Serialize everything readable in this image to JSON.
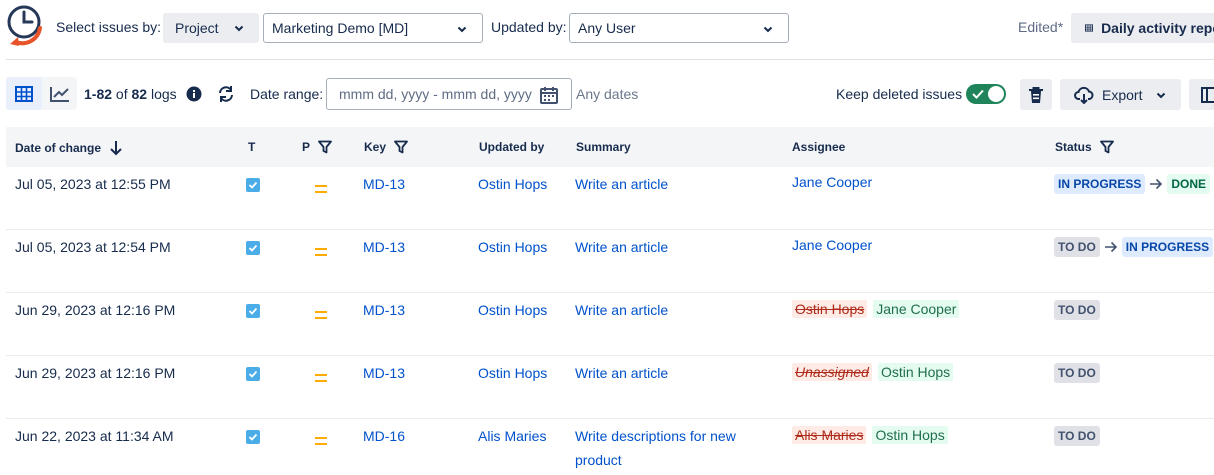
{
  "header": {
    "select_issues_label": "Select issues by:",
    "scope_button": "Project",
    "project_value": "Marketing Demo [MD]",
    "updated_by_label": "Updated by:",
    "updated_by_value": "Any User",
    "edited_label": "Edited*",
    "report_button": "Daily activity report"
  },
  "toolbar": {
    "logs_range": "1-82",
    "logs_of": "of",
    "logs_total": "82",
    "logs_word": "logs",
    "date_range_label": "Date range:",
    "date_placeholder": "mmm dd, yyyy - mmm dd, yyyy",
    "any_dates": "Any dates",
    "keep_deleted_label": "Keep deleted issues",
    "keep_deleted_on": true,
    "export_label": "Export"
  },
  "table": {
    "columns": {
      "date": "Date of change",
      "type": "T",
      "priority": "P",
      "key": "Key",
      "updated_by": "Updated by",
      "summary": "Summary",
      "assignee": "Assignee",
      "status": "Status"
    },
    "rows": [
      {
        "date": "Jul 05, 2023 at 12:55 PM",
        "key": "MD-13",
        "updated_by": "Ostin Hops",
        "summary": "Write an article",
        "assignee": "Jane Cooper",
        "status_from": "IN PROGRESS",
        "status_to": "DONE"
      },
      {
        "date": "Jul 05, 2023 at 12:54 PM",
        "key": "MD-13",
        "updated_by": "Ostin Hops",
        "summary": "Write an article",
        "assignee": "Jane Cooper",
        "status_from": "TO DO",
        "status_to": "IN PROGRESS"
      },
      {
        "date": "Jun 29, 2023 at 12:16 PM",
        "key": "MD-13",
        "updated_by": "Ostin Hops",
        "summary": "Write an article",
        "assignee_old": "Ostin Hops",
        "assignee_new": "Jane Cooper",
        "status": "TO DO"
      },
      {
        "date": "Jun 29, 2023 at 12:16 PM",
        "key": "MD-13",
        "updated_by": "Ostin Hops",
        "summary": "Write an article",
        "assignee_old": "Unassigned",
        "assignee_new": "Ostin Hops",
        "status": "TO DO"
      },
      {
        "date": "Jun 22, 2023 at 11:34 AM",
        "key": "MD-16",
        "updated_by": "Alis Maries",
        "summary": "Write descriptions for new product",
        "assignee_old": "Alis Maries",
        "assignee_new": "Ostin Hops",
        "status": "TO DO"
      }
    ]
  },
  "colors": {
    "link": "#0052cc",
    "toggle_on": "#1f845a",
    "priority_medium": "#ffab00",
    "logo_orange": "#e8542a",
    "logo_blue": "#253858"
  },
  "icons": [
    "app-logo-icon",
    "chevron-down-icon",
    "table-icon",
    "grid-view-icon",
    "chart-view-icon",
    "info-icon",
    "refresh-icon",
    "calendar-icon",
    "check-icon",
    "trash-icon",
    "cloud-download-icon",
    "columns-icon",
    "sort-down-icon",
    "filter-icon",
    "checkbox-task-icon",
    "priority-medium-icon",
    "arrow-right-icon"
  ]
}
